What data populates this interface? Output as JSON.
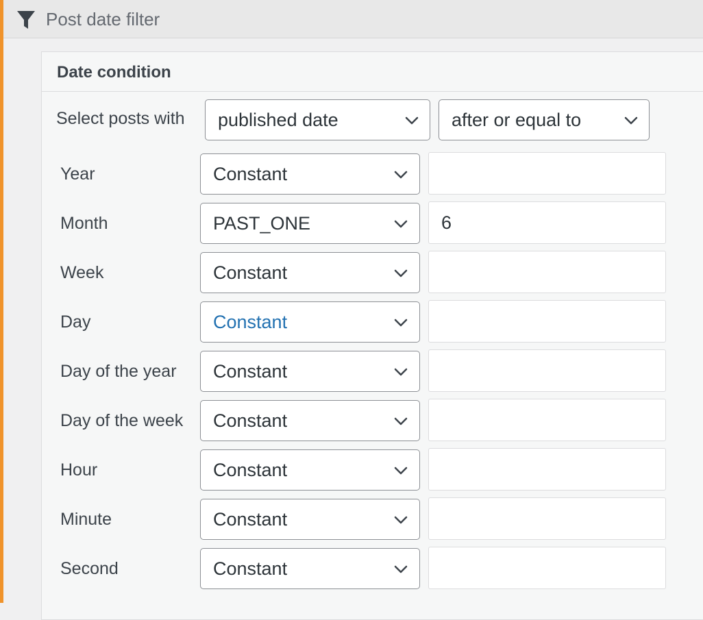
{
  "header": {
    "title": "Post date filter",
    "icon": "filter-icon"
  },
  "card": {
    "title": "Date condition"
  },
  "selector": {
    "label": "Select posts with",
    "date_type": "published date",
    "comparison": "after or equal to"
  },
  "rows": [
    {
      "label": "Year",
      "mode": "Constant",
      "value": ""
    },
    {
      "label": "Month",
      "mode": "PAST_ONE",
      "value": "6"
    },
    {
      "label": "Week",
      "mode": "Constant",
      "value": ""
    },
    {
      "label": "Day",
      "mode": "Constant",
      "value": ""
    },
    {
      "label": "Day of the year",
      "mode": "Constant",
      "value": ""
    },
    {
      "label": "Day of the week",
      "mode": "Constant",
      "value": ""
    },
    {
      "label": "Hour",
      "mode": "Constant",
      "value": ""
    },
    {
      "label": "Minute",
      "mode": "Constant",
      "value": ""
    },
    {
      "label": "Second",
      "mode": "Constant",
      "value": ""
    }
  ],
  "colors": {
    "accent": "#f0932b",
    "link_blue": "#2271b1"
  }
}
